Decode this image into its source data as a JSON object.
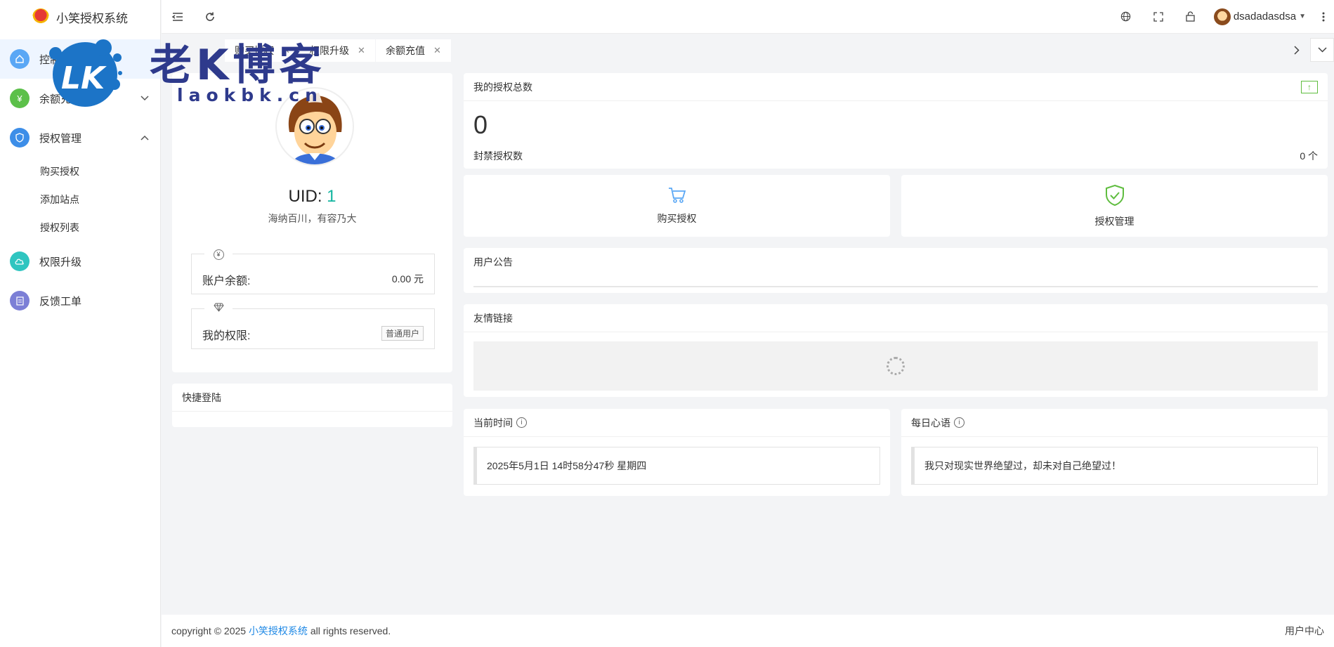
{
  "app": {
    "title": "小笑授权系统"
  },
  "sidebar": {
    "items": [
      {
        "label": "控制台",
        "icon": "home-icon",
        "color": "#5aa7f5"
      },
      {
        "label": "余额充值",
        "icon": "yen-icon",
        "color": "#5cc04a"
      },
      {
        "label": "授权管理",
        "icon": "shield-icon",
        "color": "#3d8ee8"
      },
      {
        "label": "权限升级",
        "icon": "cloud-icon",
        "color": "#2fc5c0"
      },
      {
        "label": "反馈工单",
        "icon": "ticket-icon",
        "color": "#7c7fd6"
      }
    ],
    "subitems": [
      "购买授权",
      "添加站点",
      "授权列表"
    ]
  },
  "header": {
    "username": "dsadadasdsa",
    "icons": [
      "menu-collapse-icon",
      "refresh-icon",
      "globe-icon",
      "fullscreen-icon",
      "lock-icon",
      "more-icon"
    ]
  },
  "tabs": [
    {
      "label": "购买授权"
    },
    {
      "label": "权限升级"
    },
    {
      "label": "余额充值"
    }
  ],
  "profile": {
    "uid_label": "UID:",
    "uid": "1",
    "motto": "海纳百川，有容乃大",
    "balance_label": "账户余额:",
    "balance_value": "0.00 元",
    "permission_label": "我的权限:",
    "permission_value": "普通用户"
  },
  "quick_login": {
    "title": "快捷登陆"
  },
  "stats": {
    "title": "我的授权总数",
    "total": "0",
    "banned_label": "封禁授权数",
    "banned_value": "0 个"
  },
  "shortcuts": [
    {
      "label": "购买授权",
      "icon": "cart-icon"
    },
    {
      "label": "授权管理",
      "icon": "shield-check-icon"
    }
  ],
  "notice": {
    "title": "用户公告"
  },
  "links": {
    "title": "友情链接"
  },
  "time": {
    "title": "当前时间",
    "value": "2025年5月1日 14时58分47秒 星期四"
  },
  "daily": {
    "title": "每日心语",
    "value": "我只对现实世界绝望过，却未对自己绝望过！"
  },
  "footer": {
    "prefix": "copyright © 2025",
    "link": "小笑授权系统",
    "suffix": "all rights reserved.",
    "right": "用户中心"
  },
  "watermark": {
    "text": "老K博客",
    "url": "laokbk.cn",
    "logo_text": "LK"
  }
}
